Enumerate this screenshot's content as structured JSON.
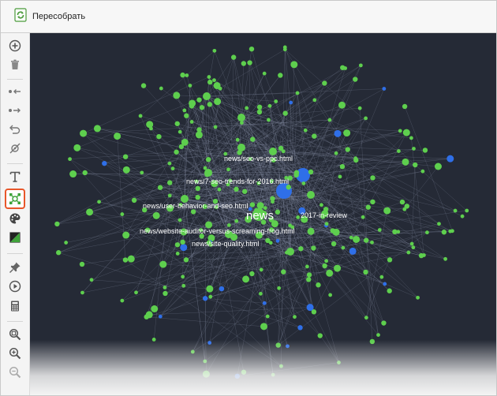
{
  "toolbar": {
    "rebuild_label": "Пересобрать"
  },
  "sidebar": {
    "tools": [
      {
        "icon": "plus-circle-icon"
      },
      {
        "icon": "trash-icon"
      },
      {
        "icon": "collapse-left-icon"
      },
      {
        "icon": "expand-right-icon"
      },
      {
        "icon": "undo-icon"
      },
      {
        "icon": "no-target-icon"
      },
      {
        "icon": "text-icon"
      },
      {
        "icon": "graph-layout-icon",
        "active": true
      },
      {
        "icon": "palette-icon"
      },
      {
        "icon": "contrast-icon"
      },
      {
        "icon": "pin-icon"
      },
      {
        "icon": "play-icon"
      },
      {
        "icon": "calculator-icon"
      },
      {
        "icon": "zoom-fit-icon"
      },
      {
        "icon": "zoom-in-icon"
      },
      {
        "icon": "zoom-out-icon"
      }
    ]
  },
  "graph": {
    "center_label": "news",
    "labels": [
      "news/seo-vs-ppc.html",
      "news/7-seo-trends-for-2016.html",
      "news/user-behavior-and-seo.html",
      "2017-in-review",
      "news/website-auditor-versus-screaming-frog.html",
      "news/site-quality.html"
    ],
    "colors": {
      "background": "#252a36",
      "node_green": "#5ecf4e",
      "node_blue": "#2f6fe8",
      "edge": "#8a93a8",
      "accent": "#e8572a"
    }
  }
}
